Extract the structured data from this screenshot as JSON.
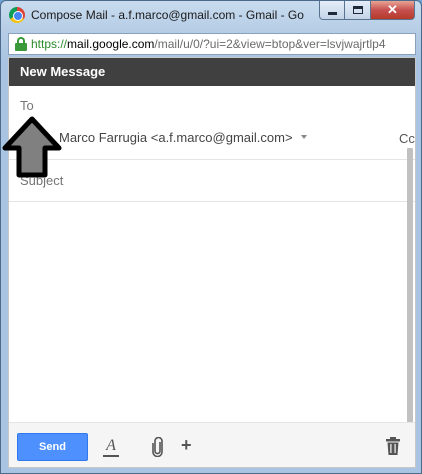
{
  "window": {
    "title": "Compose Mail - a.f.marco@gmail.com - Gmail - Go"
  },
  "address_bar": {
    "scheme": "https://",
    "host": "mail.google.com",
    "path": "/mail/u/0/?ui=2&view=btop&ver=lsvjwajrtlp4"
  },
  "compose": {
    "header_title": "New Message",
    "to_label": "To",
    "from_value": "Marco Farrugia <a.f.marco@gmail.com>",
    "cc_label": "Cc",
    "subject_placeholder": "Subject",
    "body_text": ""
  },
  "toolbar": {
    "send_label": "Send",
    "format_glyph": "A",
    "more_glyph": "+"
  },
  "colors": {
    "header_bg": "#404040",
    "send_bg": "#4d90fe",
    "secure_green": "#2a8b2a"
  },
  "icons": [
    "chrome-icon",
    "lock-icon",
    "dropdown-caret-icon",
    "format-text-icon",
    "paperclip-icon",
    "plus-icon",
    "trash-icon",
    "up-arrow-annotation-icon"
  ]
}
